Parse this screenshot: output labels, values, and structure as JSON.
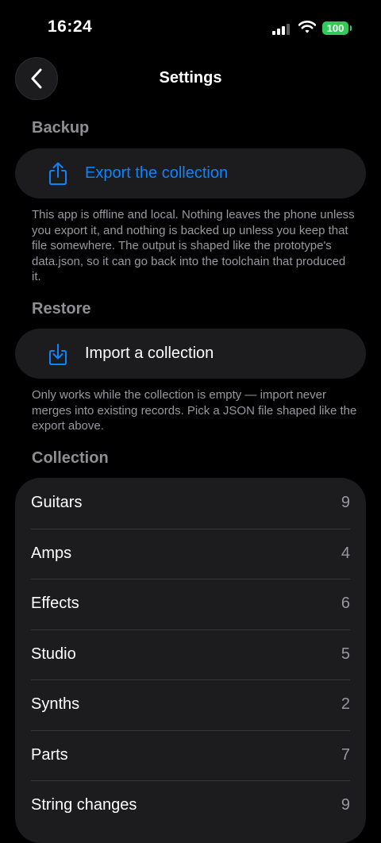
{
  "status_bar": {
    "time": "16:24",
    "battery": "100"
  },
  "header": {
    "title": "Settings"
  },
  "backup": {
    "section_label": "Backup",
    "export_label": "Export the collection",
    "note": "This app is offline and local. Nothing leaves the phone unless you export it, and nothing is backed up unless you keep that file somewhere. The output is shaped like the prototype's data.json, so it can go back into the toolchain that produced it."
  },
  "restore": {
    "section_label": "Restore",
    "import_label": "Import a collection",
    "note": "Only works while the collection is empty — import never merges into existing records. Pick a JSON file shaped like the export above."
  },
  "collection": {
    "section_label": "Collection",
    "items": [
      {
        "name": "Guitars",
        "count": "9"
      },
      {
        "name": "Amps",
        "count": "4"
      },
      {
        "name": "Effects",
        "count": "6"
      },
      {
        "name": "Studio",
        "count": "5"
      },
      {
        "name": "Synths",
        "count": "2"
      },
      {
        "name": "Parts",
        "count": "7"
      },
      {
        "name": "String changes",
        "count": "9"
      }
    ]
  },
  "colors": {
    "accent": "#0a84ff",
    "battery": "#34c759",
    "card": "#1c1c1e"
  }
}
